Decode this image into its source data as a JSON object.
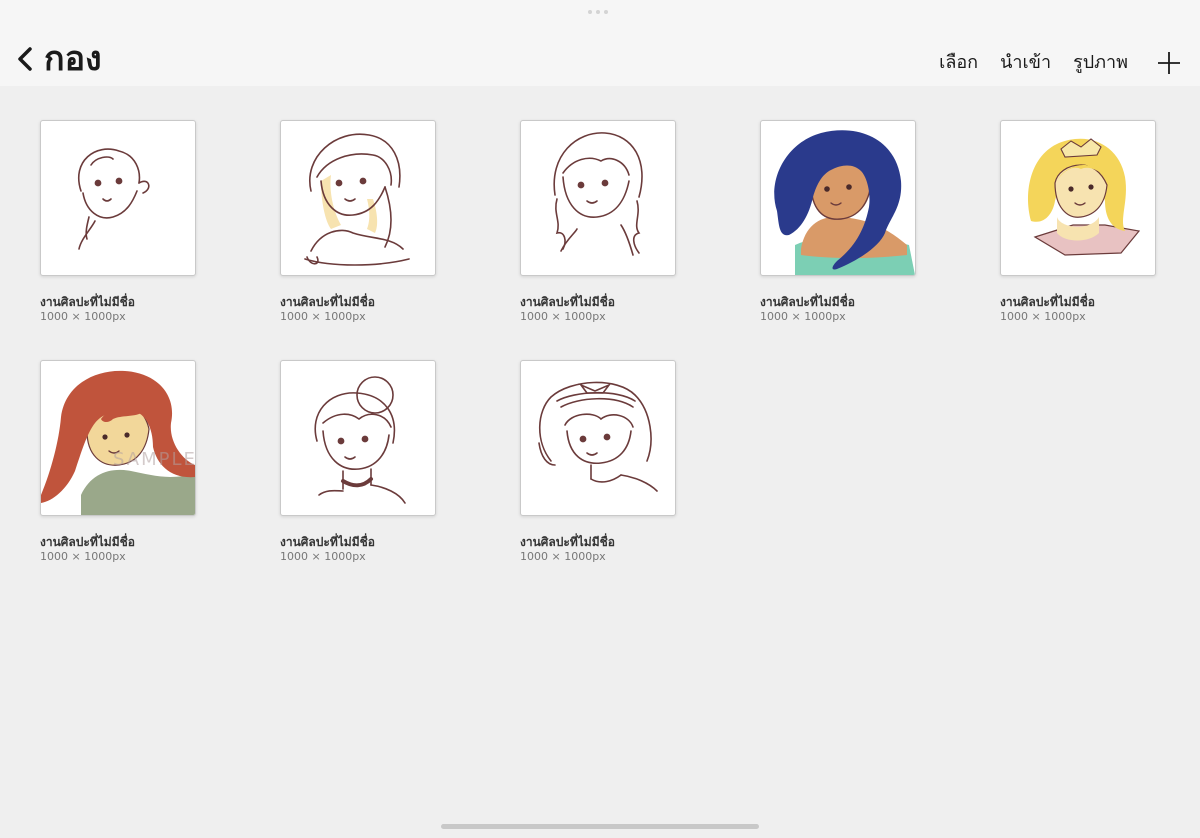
{
  "header": {
    "title": "กอง",
    "actions": {
      "select": "เลือก",
      "import": "นำเข้า",
      "photo": "รูปภาพ"
    }
  },
  "artworks": [
    {
      "name": "งานศิลปะที่ไม่มีชื่อ",
      "size": "1000 × 1000px",
      "thumbnail": "line-sketch-girl-short-hair"
    },
    {
      "name": "งานศิลปะที่ไม่มีชื่อ",
      "size": "1000 × 1000px",
      "thumbnail": "line-sketch-girl-braid-yellow-tint"
    },
    {
      "name": "งานศิลปะที่ไม่มีชื่อ",
      "size": "1000 × 1000px",
      "thumbnail": "line-sketch-girl-pigtail-braids"
    },
    {
      "name": "งานศิลปะที่ไม่มีชื่อ",
      "size": "1000 × 1000px",
      "thumbnail": "color-girl-dark-blue-hair"
    },
    {
      "name": "งานศิลปะที่ไม่มีชื่อ",
      "size": "1000 × 1000px",
      "thumbnail": "color-girl-blonde-tiara"
    },
    {
      "name": "งานศิลปะที่ไม่มีชื่อ",
      "size": "1000 × 1000px",
      "thumbnail": "color-girl-red-hair"
    },
    {
      "name": "งานศิลปะที่ไม่มีชื่อ",
      "size": "1000 × 1000px",
      "thumbnail": "line-sketch-girl-bun-choker"
    },
    {
      "name": "งานศิลปะที่ไม่มีชื่อ",
      "size": "1000 × 1000px",
      "thumbnail": "line-sketch-girl-headband-bow"
    }
  ],
  "watermark": "SAMPLE",
  "colors": {
    "background": "#efefef",
    "header": "#f6f6f6",
    "line_art": "#6b3b3b",
    "blue_hair": "#2a3a8c",
    "blonde_hair": "#f4d55a",
    "red_hair": "#c0543c",
    "skin_tan": "#d99a68",
    "skin_light": "#f7e3b0",
    "teal": "#7ccfb4"
  }
}
